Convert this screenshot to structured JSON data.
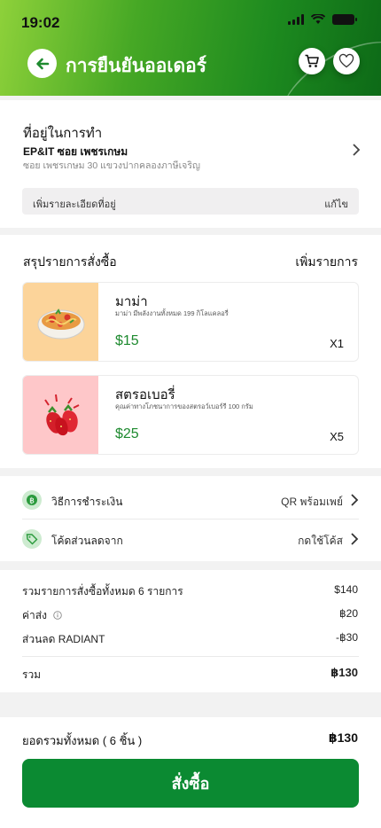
{
  "status_bar": {
    "time": "19:02"
  },
  "header": {
    "title": "การยืนยันออเดอร์"
  },
  "address": {
    "label": "ที่อยู่ในการทำ",
    "name": "EP&IT ซอย เพชรเกษม",
    "detail": "ซอย เพชรเกษม 30 แขวงปากคลองภาษีเจริญ",
    "extra_label": "เพิ่มรายละเอียดที่อยู่",
    "edit_label": "แก้ไข"
  },
  "order": {
    "title": "สรุปรายการสั่งซื้อ",
    "add_label": "เพิ่มรายการ",
    "items": [
      {
        "name": "มาม่า",
        "desc": "มาม่า มีพลังงานทั้งหมด 199 กิโลแคลอรี่",
        "price": "$15",
        "qty": "X1",
        "bg": "#fcd49a"
      },
      {
        "name": "สตรอเบอรี่",
        "desc": "คุณค่าทางโภชนาการของสตรอว์เบอร์รี 100 กรัม",
        "price": "$25",
        "qty": "X5",
        "bg": "#fec7c9"
      }
    ]
  },
  "payment": {
    "method_label": "วิธีการชำระเงิน",
    "method_value": "QR พร้อมเพย์",
    "discount_label": "โค้ดส่วนลดจาก",
    "discount_value": "กดใช้โค้ส"
  },
  "totals": {
    "subtotal_label": "รวมรายการสั่งซื้อทั้งหมด 6 รายการ",
    "subtotal_value": "$140",
    "delivery_label": "ค่าส่ง",
    "delivery_value": "฿20",
    "discount_label": "ส่วนลด RADIANT",
    "discount_value": "-฿30",
    "total_label": "รวม",
    "total_value": "฿130"
  },
  "footer": {
    "grand_label": "ยอดรวมทั้งหมด ( 6 ชิ้น )",
    "grand_value": "฿130",
    "order_button": "สั่งซื้อ"
  },
  "colors": {
    "primary_green": "#0b8a32",
    "price_green": "#1e8a2f",
    "icon_bg": "#cdebd0"
  }
}
